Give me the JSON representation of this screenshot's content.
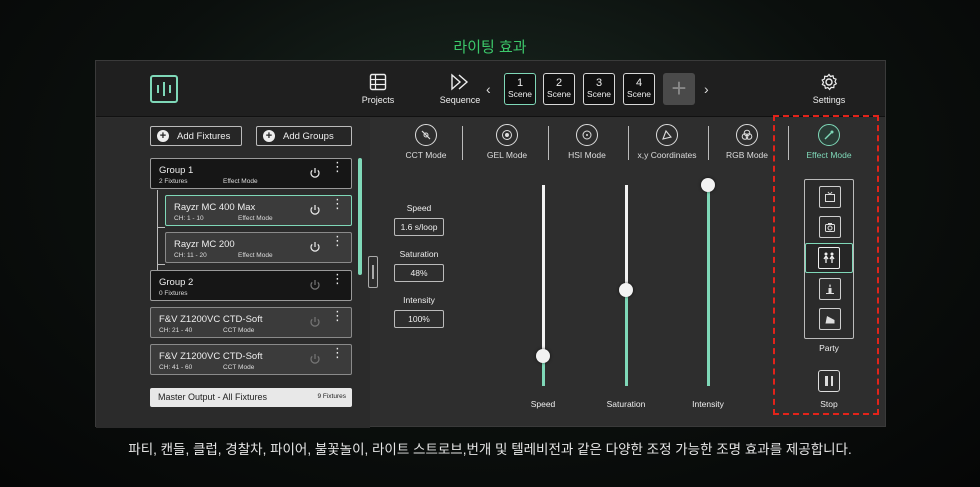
{
  "heading": "라이팅 효과",
  "caption": "파티, 캔들, 클럽, 경찰차, 파이어, 불꽃놀이, 라이트 스트로브,번개 및 텔레비전과 같은 다양한 조정 가능한 조명 효과를 제공합니다.",
  "colors": {
    "accent": "#7fd8b8",
    "heading": "#3cc86a",
    "highlight": "#e2231a"
  },
  "topbar": {
    "logo_icon": "app-logo-icon",
    "projects_label": "Projects",
    "sequence_label": "Sequence",
    "settings_label": "Settings",
    "scenes": [
      {
        "num": "1",
        "label": "Scene"
      },
      {
        "num": "2",
        "label": "Scene"
      },
      {
        "num": "3",
        "label": "Scene"
      },
      {
        "num": "4",
        "label": "Scene"
      }
    ],
    "add_scene": "+",
    "prev": "‹",
    "next": "›"
  },
  "left": {
    "add_fixtures": "Add Fixtures",
    "add_groups": "Add Groups",
    "fixtures": [
      {
        "name": "Group 1",
        "sub": "2 Fixtures",
        "mode": "Effect Mode"
      },
      {
        "name": "Rayzr MC 400 Max",
        "sub": "CH: 1 - 10",
        "mode": "Effect Mode"
      },
      {
        "name": "Rayzr MC 200",
        "sub": "CH: 11 - 20",
        "mode": "Effect Mode"
      },
      {
        "name": "Group 2",
        "sub": "0 Fixtures",
        "mode": ""
      },
      {
        "name": "F&V Z1200VC CTD-Soft",
        "sub": "CH: 21 - 40",
        "mode": "CCT Mode"
      },
      {
        "name": "F&V Z1200VC CTD-Soft",
        "sub": "CH: 41 - 60",
        "mode": "CCT Mode"
      }
    ],
    "master_label": "Master Output - All Fixtures",
    "master_count": "9 Fixtures"
  },
  "modes": [
    {
      "label": "CCT Mode"
    },
    {
      "label": "GEL Mode"
    },
    {
      "label": "HSI Mode"
    },
    {
      "label": "x,y Coordinates"
    },
    {
      "label": "RGB Mode"
    },
    {
      "label": "Effect Mode"
    }
  ],
  "params": {
    "speed_label": "Speed",
    "speed_value": "1.6 s/loop",
    "saturation_label": "Saturation",
    "saturation_value": "48%",
    "intensity_label": "Intensity",
    "intensity_value": "100%"
  },
  "sliders": [
    {
      "label": "Speed",
      "level": 0.15
    },
    {
      "label": "Saturation",
      "level": 0.48
    },
    {
      "label": "Intensity",
      "level": 1.0
    }
  ],
  "effects": {
    "items": [
      "tv-icon",
      "camera-icon",
      "party-icon",
      "candle-icon",
      "fireworks-icon"
    ],
    "selected_label": "Party",
    "stop_label": "Stop"
  }
}
